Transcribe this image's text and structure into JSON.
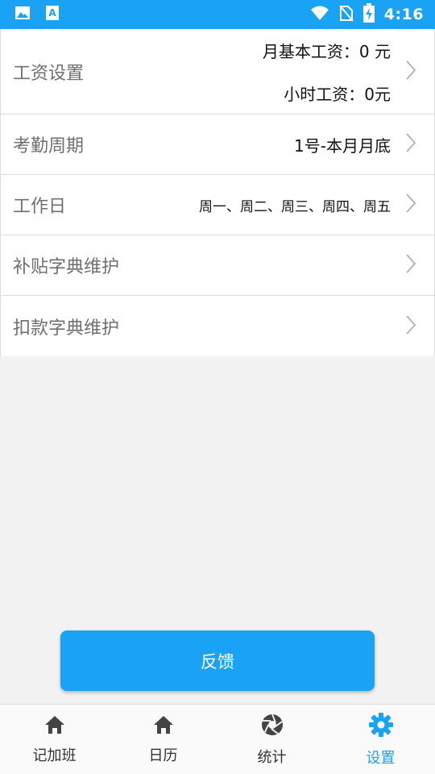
{
  "status_bar": {
    "time": "4:16",
    "icons": [
      "image-icon",
      "text-notification-icon",
      "wifi-icon",
      "no-sim-icon",
      "battery-charging-icon"
    ]
  },
  "settings": {
    "salary": {
      "label": "工资设置",
      "monthly": "月基本工资：0 元",
      "hourly": "小时工资：0元"
    },
    "period": {
      "label": "考勤周期",
      "value": "1号-本月月底"
    },
    "workdays": {
      "label": "工作日",
      "value": "周一、周二、周三、周四、周五"
    },
    "allowance": {
      "label": "补贴字典维护"
    },
    "deduction": {
      "label": "扣款字典维护"
    }
  },
  "feedback_label": "反馈",
  "tabs": [
    {
      "label": "记加班",
      "icon": "home-icon",
      "active": false
    },
    {
      "label": "日历",
      "icon": "home-icon",
      "active": false
    },
    {
      "label": "统计",
      "icon": "aperture-icon",
      "active": false
    },
    {
      "label": "设置",
      "icon": "gear-icon",
      "active": true
    }
  ],
  "colors": {
    "accent": "#1aa3f5",
    "tab_inactive": "#333333",
    "label_gray": "#6f6f6f"
  }
}
